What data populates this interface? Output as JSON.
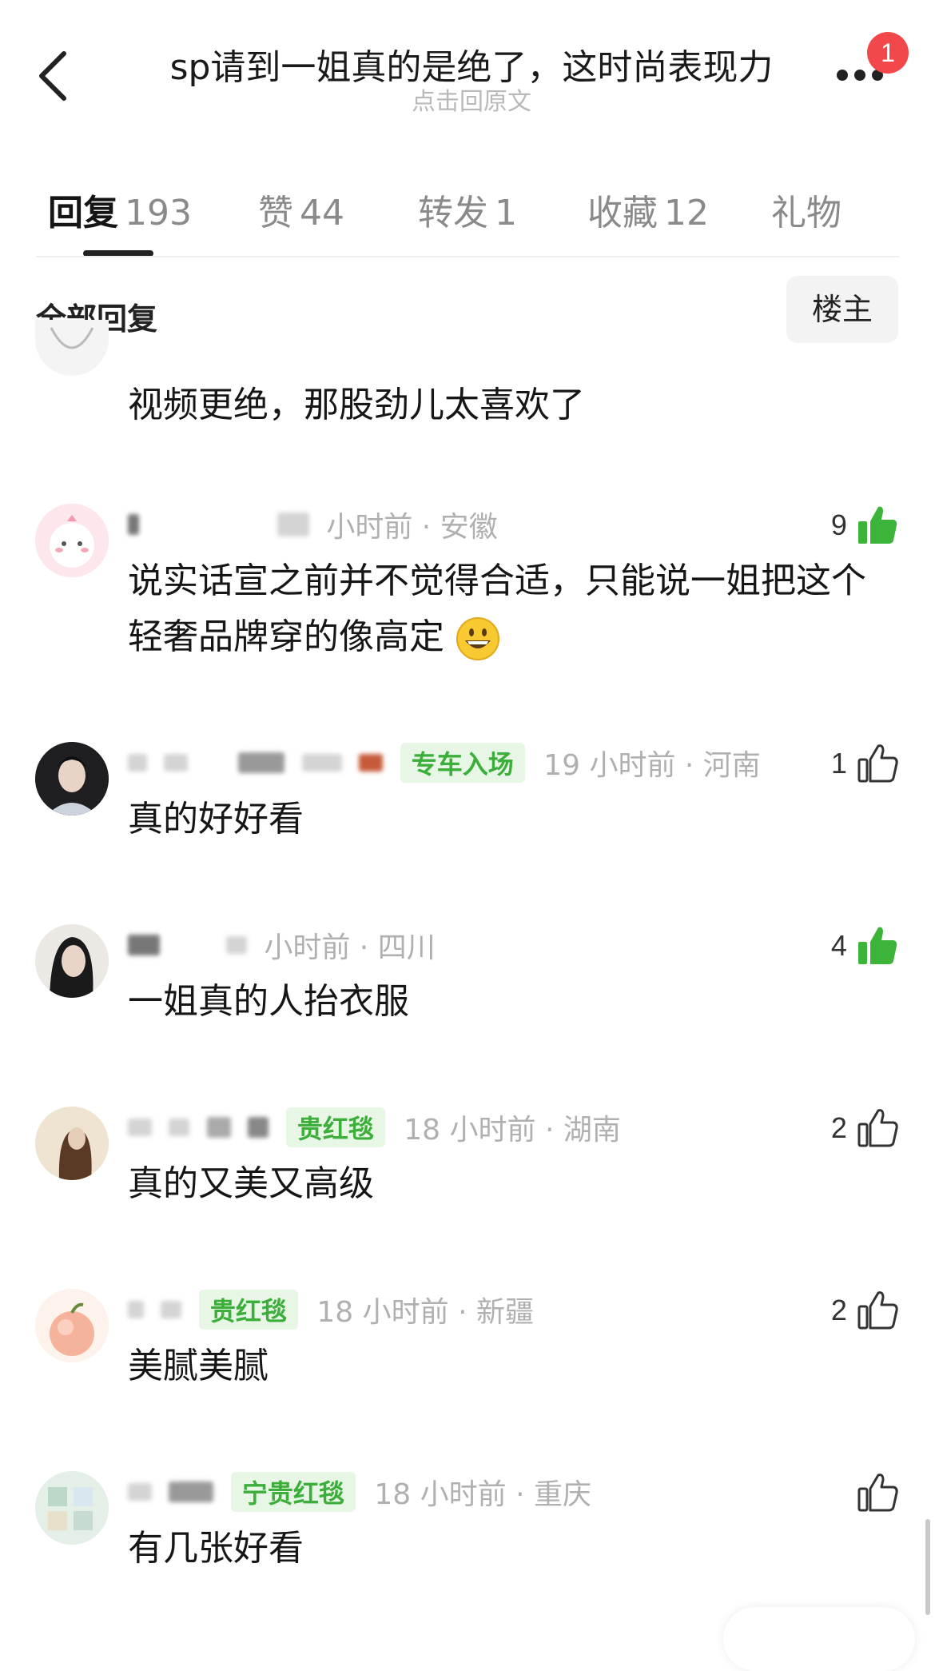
{
  "header": {
    "title": "sp请到一姐真的是绝了，这时尚表现力",
    "subtitle": "点击回原文",
    "notification_count": "1"
  },
  "tabs": [
    {
      "label": "回复",
      "count": "193",
      "active": true
    },
    {
      "label": "赞",
      "count": "44"
    },
    {
      "label": "转发",
      "count": "1"
    },
    {
      "label": "收藏",
      "count": "12"
    },
    {
      "label": "礼物",
      "count": ""
    }
  ],
  "filter": {
    "label": "全部回复",
    "op_button": "楼主"
  },
  "comments": [
    {
      "meta": "",
      "text": "视频更绝，那股劲儿太喜欢了",
      "likes": ""
    },
    {
      "meta": "小时前 · 安徽",
      "text": "说实话宣之前并不觉得合适，只能说一姐把这个轻奢品牌穿的像高定",
      "likes": "9",
      "liked": true
    },
    {
      "tag": "专车入场",
      "meta": "19 小时前 · 河南",
      "text": "真的好好看",
      "likes": "1"
    },
    {
      "meta": "小时前 · 四川",
      "text": "一姐真的人抬衣服",
      "likes": "4",
      "liked": true
    },
    {
      "tag": "贵红毯",
      "meta": "18 小时前 · 湖南",
      "text": "真的又美又高级",
      "likes": "2"
    },
    {
      "tag": "贵红毯",
      "meta": "18 小时前 · 新疆",
      "text": "美腻美腻",
      "likes": "2"
    },
    {
      "tag": "宁贵红毯",
      "meta": "18 小时前 · 重庆",
      "text": "有几张好看",
      "likes": ""
    }
  ],
  "colors": {
    "accent_green": "#3cae3a",
    "badge_red": "#f2484b"
  },
  "icons": [
    "back-icon",
    "more-icon",
    "thumbs-up-icon",
    "thumbs-up-filled-icon",
    "grinning-emoji-icon"
  ]
}
